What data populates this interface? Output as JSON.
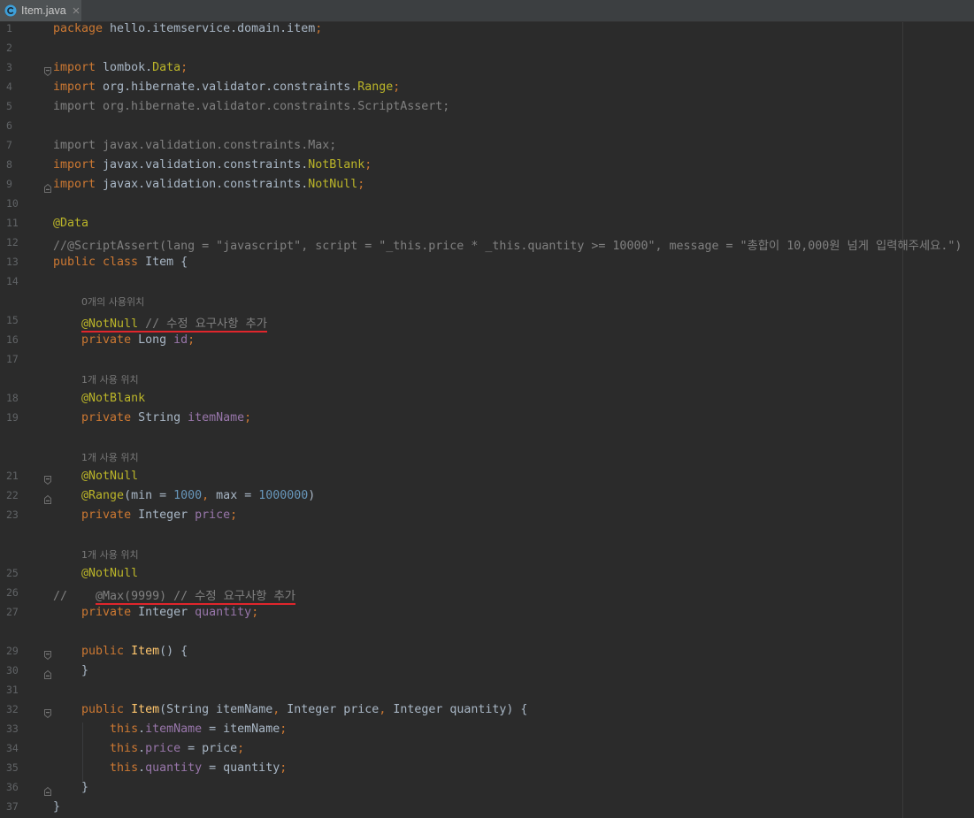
{
  "theme": {
    "editor_background": "#2b2b2b",
    "tab_bar_background": "#3c3f41",
    "active_tab_background": "#4e5254",
    "keyword": "#cc7832",
    "annotation": "#bbb529",
    "field": "#9876aa",
    "number": "#6897bb",
    "text": "#a9b7c6",
    "comment": "#808080",
    "unused": "#808080",
    "method": "#ffc66d",
    "hint": "#787878",
    "line_number": "#606366",
    "red_underline": "#e0262c",
    "class_icon": "#3e9fd8"
  },
  "tabs": [
    {
      "label": "Item.java",
      "icon": "java-class-icon",
      "close_icon": "close-icon"
    }
  ],
  "editor": {
    "lines": [
      {
        "num": "1",
        "tokens": [
          {
            "text": "package",
            "type": "keyword"
          },
          {
            "text": " hello.itemservice.domain.item",
            "type": "text"
          },
          {
            "text": ";",
            "type": "keyword"
          }
        ]
      },
      {
        "num": "2",
        "tokens": []
      },
      {
        "num": "3",
        "fold": "fold-start",
        "tokens": [
          {
            "text": "import",
            "type": "keyword"
          },
          {
            "text": " lombok.",
            "type": "text"
          },
          {
            "text": "Data",
            "type": "annotation"
          },
          {
            "text": ";",
            "type": "keyword"
          }
        ]
      },
      {
        "num": "4",
        "tokens": [
          {
            "text": "import",
            "type": "keyword"
          },
          {
            "text": " org.hibernate.validator.constraints.",
            "type": "text"
          },
          {
            "text": "Range",
            "type": "annotation"
          },
          {
            "text": ";",
            "type": "keyword"
          }
        ]
      },
      {
        "num": "5",
        "tokens": [
          {
            "text": "import org.hibernate.validator.constraints.ScriptAssert;",
            "type": "unused"
          }
        ]
      },
      {
        "num": "6",
        "tokens": []
      },
      {
        "num": "7",
        "tokens": [
          {
            "text": "import javax.validation.constraints.Max;",
            "type": "unused"
          }
        ]
      },
      {
        "num": "8",
        "tokens": [
          {
            "text": "import",
            "type": "keyword"
          },
          {
            "text": " javax.validation.constraints.",
            "type": "text"
          },
          {
            "text": "NotBlank",
            "type": "annotation"
          },
          {
            "text": ";",
            "type": "keyword"
          }
        ]
      },
      {
        "num": "9",
        "fold": "fold-end",
        "tokens": [
          {
            "text": "import",
            "type": "keyword"
          },
          {
            "text": " javax.validation.constraints.",
            "type": "text"
          },
          {
            "text": "NotNull",
            "type": "annotation"
          },
          {
            "text": ";",
            "type": "keyword"
          }
        ]
      },
      {
        "num": "10",
        "tokens": []
      },
      {
        "num": "11",
        "tokens": [
          {
            "text": "@Data",
            "type": "annotation"
          }
        ]
      },
      {
        "num": "12",
        "tokens": [
          {
            "text": "//@ScriptAssert(lang = \"javascript\", script = \"_this.price * _this.quantity >= 10000\", message = \"총합이 10,000원 넘게 입력해주세요.\")",
            "type": "comment"
          }
        ]
      },
      {
        "num": "13",
        "tokens": [
          {
            "text": "public class",
            "type": "keyword"
          },
          {
            "text": " Item {",
            "type": "text"
          }
        ]
      },
      {
        "num": "14",
        "tokens": []
      },
      {
        "hint": "0개의 사용위치"
      },
      {
        "num": "15",
        "tokens": [
          {
            "text": "    ",
            "type": "text"
          },
          {
            "text": "@NotNull",
            "type": "annotation",
            "red_underline": true
          },
          {
            "text": " // 수정 요구사항 추가",
            "type": "comment",
            "red_underline": true
          }
        ]
      },
      {
        "num": "16",
        "tokens": [
          {
            "text": "    ",
            "type": "text"
          },
          {
            "text": "private",
            "type": "keyword"
          },
          {
            "text": " Long ",
            "type": "text"
          },
          {
            "text": "id",
            "type": "field"
          },
          {
            "text": ";",
            "type": "keyword"
          }
        ]
      },
      {
        "num": "17",
        "tokens": []
      },
      {
        "hint": "1개 사용 위치"
      },
      {
        "num": "18",
        "tokens": [
          {
            "text": "    ",
            "type": "text"
          },
          {
            "text": "@NotBlank",
            "type": "annotation"
          }
        ]
      },
      {
        "num": "19",
        "tokens": [
          {
            "text": "    ",
            "type": "text"
          },
          {
            "text": "private",
            "type": "keyword"
          },
          {
            "text": " String ",
            "type": "text"
          },
          {
            "text": "itemName",
            "type": "field"
          },
          {
            "text": ";",
            "type": "keyword"
          }
        ]
      },
      {
        "num": "",
        "tokens": []
      },
      {
        "hint": "1개 사용 위치"
      },
      {
        "num": "21",
        "fold": "fold-start",
        "tokens": [
          {
            "text": "    ",
            "type": "text"
          },
          {
            "text": "@NotNull",
            "type": "annotation"
          }
        ]
      },
      {
        "num": "22",
        "fold": "fold-end",
        "tokens": [
          {
            "text": "    ",
            "type": "text"
          },
          {
            "text": "@Range",
            "type": "annotation"
          },
          {
            "text": "(min = ",
            "type": "text"
          },
          {
            "text": "1000",
            "type": "number"
          },
          {
            "text": ",",
            "type": "keyword"
          },
          {
            "text": " max = ",
            "type": "text"
          },
          {
            "text": "1000000",
            "type": "number"
          },
          {
            "text": ")",
            "type": "text"
          }
        ]
      },
      {
        "num": "23",
        "tokens": [
          {
            "text": "    ",
            "type": "text"
          },
          {
            "text": "private",
            "type": "keyword"
          },
          {
            "text": " Integer ",
            "type": "text"
          },
          {
            "text": "price",
            "type": "field"
          },
          {
            "text": ";",
            "type": "keyword"
          }
        ]
      },
      {
        "num": "",
        "tokens": []
      },
      {
        "hint": "1개 사용 위치"
      },
      {
        "num": "25",
        "tokens": [
          {
            "text": "    ",
            "type": "text"
          },
          {
            "text": "@NotNull",
            "type": "annotation"
          }
        ]
      },
      {
        "num": "26",
        "tokens": [
          {
            "text": "//    ",
            "type": "comment"
          },
          {
            "text": "@Max(9999) // 수정 요구사항 추가",
            "type": "comment",
            "red_underline": true
          }
        ]
      },
      {
        "num": "27",
        "tokens": [
          {
            "text": "    ",
            "type": "text"
          },
          {
            "text": "private",
            "type": "keyword"
          },
          {
            "text": " Integer ",
            "type": "text"
          },
          {
            "text": "quantity",
            "type": "field"
          },
          {
            "text": ";",
            "type": "keyword"
          }
        ]
      },
      {
        "num": "",
        "tokens": []
      },
      {
        "num": "29",
        "fold": "fold-start",
        "tokens": [
          {
            "text": "    ",
            "type": "text"
          },
          {
            "text": "public",
            "type": "keyword"
          },
          {
            "text": " ",
            "type": "text"
          },
          {
            "text": "Item",
            "type": "method"
          },
          {
            "text": "() {",
            "type": "text"
          }
        ]
      },
      {
        "num": "30",
        "fold": "fold-end",
        "tokens": [
          {
            "text": "    }",
            "type": "text"
          }
        ]
      },
      {
        "num": "31",
        "tokens": []
      },
      {
        "num": "32",
        "fold": "fold-start",
        "tokens": [
          {
            "text": "    ",
            "type": "text"
          },
          {
            "text": "public",
            "type": "keyword"
          },
          {
            "text": " ",
            "type": "text"
          },
          {
            "text": "Item",
            "type": "method"
          },
          {
            "text": "(String itemName",
            "type": "text"
          },
          {
            "text": ",",
            "type": "keyword"
          },
          {
            "text": " Integer price",
            "type": "text"
          },
          {
            "text": ",",
            "type": "keyword"
          },
          {
            "text": " Integer quantity) {",
            "type": "text"
          }
        ]
      },
      {
        "num": "33",
        "tokens": [
          {
            "text": "        ",
            "type": "text"
          },
          {
            "text": "this",
            "type": "keyword"
          },
          {
            "text": ".",
            "type": "text"
          },
          {
            "text": "itemName",
            "type": "field"
          },
          {
            "text": " = itemName",
            "type": "text"
          },
          {
            "text": ";",
            "type": "keyword"
          }
        ]
      },
      {
        "num": "34",
        "tokens": [
          {
            "text": "        ",
            "type": "text"
          },
          {
            "text": "this",
            "type": "keyword"
          },
          {
            "text": ".",
            "type": "text"
          },
          {
            "text": "price",
            "type": "field"
          },
          {
            "text": " = price",
            "type": "text"
          },
          {
            "text": ";",
            "type": "keyword"
          }
        ]
      },
      {
        "num": "35",
        "tokens": [
          {
            "text": "        ",
            "type": "text"
          },
          {
            "text": "this",
            "type": "keyword"
          },
          {
            "text": ".",
            "type": "text"
          },
          {
            "text": "quantity",
            "type": "field"
          },
          {
            "text": " = quantity",
            "type": "text"
          },
          {
            "text": ";",
            "type": "keyword"
          }
        ]
      },
      {
        "num": "36",
        "fold": "fold-end",
        "tokens": [
          {
            "text": "    }",
            "type": "text"
          }
        ]
      },
      {
        "num": "37",
        "tokens": [
          {
            "text": "}",
            "type": "text"
          }
        ]
      }
    ]
  }
}
